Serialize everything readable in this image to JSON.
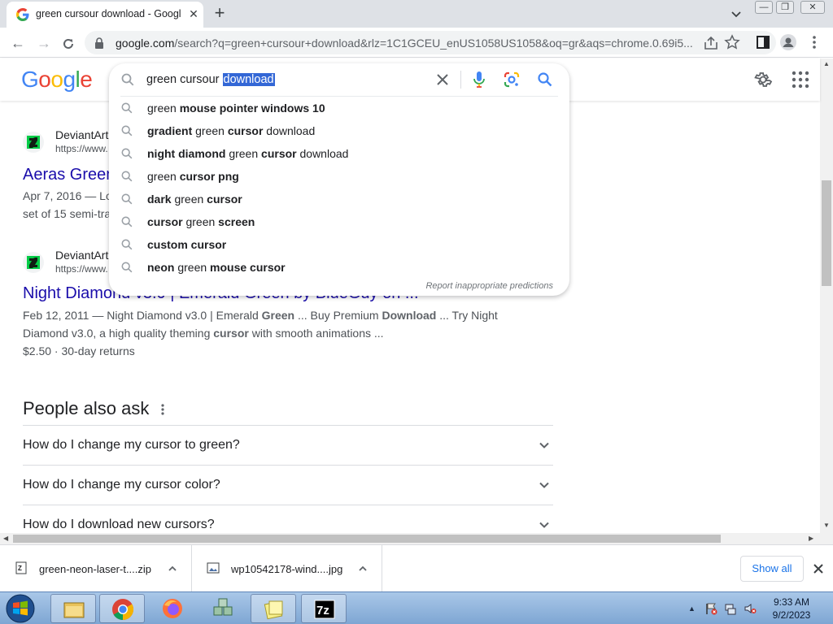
{
  "browser": {
    "tab_title": "green cursour download - Googl",
    "url_host": "google.com",
    "url_rest": "/search?q=green+cursour+download&rlz=1C1GCEU_enUS1058US1058&oq=gr&aqs=chrome.0.69i5..."
  },
  "search": {
    "query_plain": "green cursour ",
    "query_selected": "download",
    "suggestions": [
      [
        {
          "t": "green "
        },
        {
          "b": "mouse pointer windows 10"
        }
      ],
      [
        {
          "b": "gradient"
        },
        {
          "t": " green "
        },
        {
          "b": "cursor"
        },
        {
          "t": " download"
        }
      ],
      [
        {
          "b": "night diamond"
        },
        {
          "t": " green "
        },
        {
          "b": "cursor"
        },
        {
          "t": " download"
        }
      ],
      [
        {
          "t": "green "
        },
        {
          "b": "cursor png"
        }
      ],
      [
        {
          "b": "dark"
        },
        {
          "t": " green "
        },
        {
          "b": "cursor"
        }
      ],
      [
        {
          "b": "cursor"
        },
        {
          "t": " green "
        },
        {
          "b": "screen"
        }
      ],
      [
        {
          "b": "custom cursor"
        }
      ],
      [
        {
          "b": "neon"
        },
        {
          "t": " green "
        },
        {
          "b": "mouse cursor"
        }
      ]
    ],
    "report_label": "Report inappropriate predictions"
  },
  "logo_text": "Google",
  "results": [
    {
      "site": "DeviantArt",
      "url": "https://www.",
      "title": "Aeras Green",
      "snippet_line1": [
        {
          "t": "Apr 7, 2016 — Lo"
        }
      ],
      "snippet_line2": [
        {
          "t": "set of 15 semi-tra"
        }
      ]
    },
    {
      "site": "DeviantArt",
      "url": "https://www.",
      "title": "Night Diamond v3.0 | Emerald Green by BlueGuy on ...",
      "snippet_line1": [
        {
          "t": "Feb 12, 2011 — Night Diamond v3.0 | Emerald "
        },
        {
          "b": "Green"
        },
        {
          "t": " ... Buy Premium "
        },
        {
          "b": "Download"
        },
        {
          "t": " ... Try Night"
        }
      ],
      "snippet_line2": [
        {
          "t": "Diamond v3.0, a high quality theming "
        },
        {
          "b": "cursor"
        },
        {
          "t": " with smooth animations ..."
        }
      ],
      "price": "$2.50 · 30-day returns"
    }
  ],
  "people_also_ask": {
    "title": "People also ask",
    "questions": [
      "How do I change my cursor to green?",
      "How do I change my cursor color?",
      "How do I download new cursors?"
    ]
  },
  "downloads": [
    {
      "name": "green-neon-laser-t....zip",
      "icon": "zip-file-icon"
    },
    {
      "name": "wp10542178-wind....jpg",
      "icon": "image-file-icon"
    }
  ],
  "show_all_label": "Show all",
  "taskbar": {
    "time": "9:33 AM",
    "date": "9/2/2023",
    "apps": [
      "file-explorer-icon",
      "chrome-icon",
      "firefox-icon",
      "app-cubes-icon",
      "sticky-notes-icon",
      "7zip-icon"
    ]
  },
  "colors": {
    "link": "#1a0dab",
    "selection": "#3367d6",
    "google_blue": "#4285f4",
    "google_red": "#ea4335",
    "google_yellow": "#fbbc05",
    "google_green": "#34a853"
  }
}
